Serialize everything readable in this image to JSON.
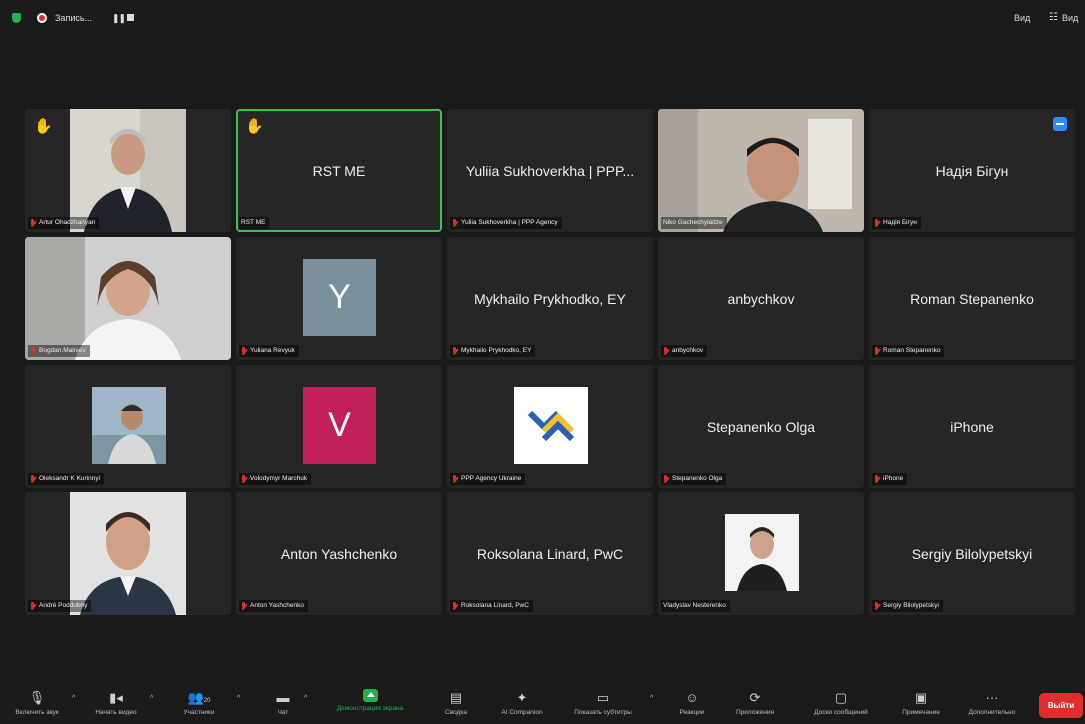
{
  "topbar": {
    "recording_label": "Запись...",
    "pause_glyph": "❚❚",
    "view_label": "Вид",
    "view_label2": "Вид"
  },
  "tiles": [
    {
      "id": "artur",
      "tag": "Artur Ohadzhanyan",
      "muted": true,
      "hand": true
    },
    {
      "id": "rst",
      "center": "RST ME",
      "tag": "RST ME",
      "muted": false,
      "hand": true,
      "active": true
    },
    {
      "id": "yuliia",
      "center": "Yuliia Sukhoverkha | PPP...",
      "tag": "Yuliia Sukhoverkha | PPP Agency",
      "muted": true
    },
    {
      "id": "niko",
      "tag": "Niko Gachechyladze",
      "muted": false
    },
    {
      "id": "nadia",
      "center": "Надія Бігун",
      "tag": "Надія Бігун",
      "muted": true
    },
    {
      "id": "bogdan",
      "tag": "Bogdan.Malniev",
      "muted": true
    },
    {
      "id": "yuliana",
      "letter": "Y",
      "letter_color": "#7a8f9c",
      "tag": "Yuliana Revyuk",
      "muted": true
    },
    {
      "id": "mykhailo",
      "center": "Mykhailo Prykhodko, EY",
      "tag": "Mykhailo Prykhodko, EY",
      "muted": true
    },
    {
      "id": "anbychkov",
      "center": "anbychkov",
      "tag": "anbychkov",
      "muted": true
    },
    {
      "id": "roman",
      "center": "Roman Stepanenko",
      "tag": "Roman Stepanenko",
      "muted": true
    },
    {
      "id": "oleksandr",
      "tag": "Oleksandr K Kurinnyi",
      "muted": true
    },
    {
      "id": "volodymyr",
      "letter": "V",
      "letter_color": "#c21f5b",
      "tag": "Volodymyr Marchuk",
      "muted": true
    },
    {
      "id": "ppp",
      "tag": "PPP Agency Ukraine",
      "muted": true
    },
    {
      "id": "olga",
      "center": "Stepanenko Olga",
      "tag": "Stepanenko Olga",
      "muted": true
    },
    {
      "id": "iphone",
      "center": "iPhone",
      "tag": "iPhone",
      "muted": true
    },
    {
      "id": "andre",
      "tag": "André Poddubny",
      "muted": true
    },
    {
      "id": "anton",
      "center": "Anton Yashchenko",
      "tag": "Anton Yashchenko",
      "muted": true
    },
    {
      "id": "roksolana",
      "center": "Roksolana Linard, PwC",
      "tag": "Roksolana Linard, PwC",
      "muted": true
    },
    {
      "id": "vladyslav",
      "tag": "Vladyslav Nesterenko",
      "muted": false
    },
    {
      "id": "sergiy",
      "center": "Sergiy Bilolypetskyi",
      "tag": "Sergiy Bilolypetskyi",
      "muted": true
    }
  ],
  "toolbar": {
    "unmute": "Включить звук",
    "start_video": "Начать видео",
    "participants": "Участники",
    "participants_count": "20",
    "chat": "Чат",
    "share": "Демонстрация экрана",
    "summary": "Сводка",
    "ai": "AI Companion",
    "captions": "Показать субтитры",
    "reactions": "Реакции",
    "apps": "Приложения",
    "whiteboards": "Доски сообщений",
    "notes": "Примечание",
    "more": "Дополнительно",
    "leave": "Выйти"
  },
  "colors": {
    "accent_green": "#22b14c",
    "active_border": "#3fbf54",
    "leave_red": "#e02d2d",
    "tile_bg": "#262626"
  }
}
